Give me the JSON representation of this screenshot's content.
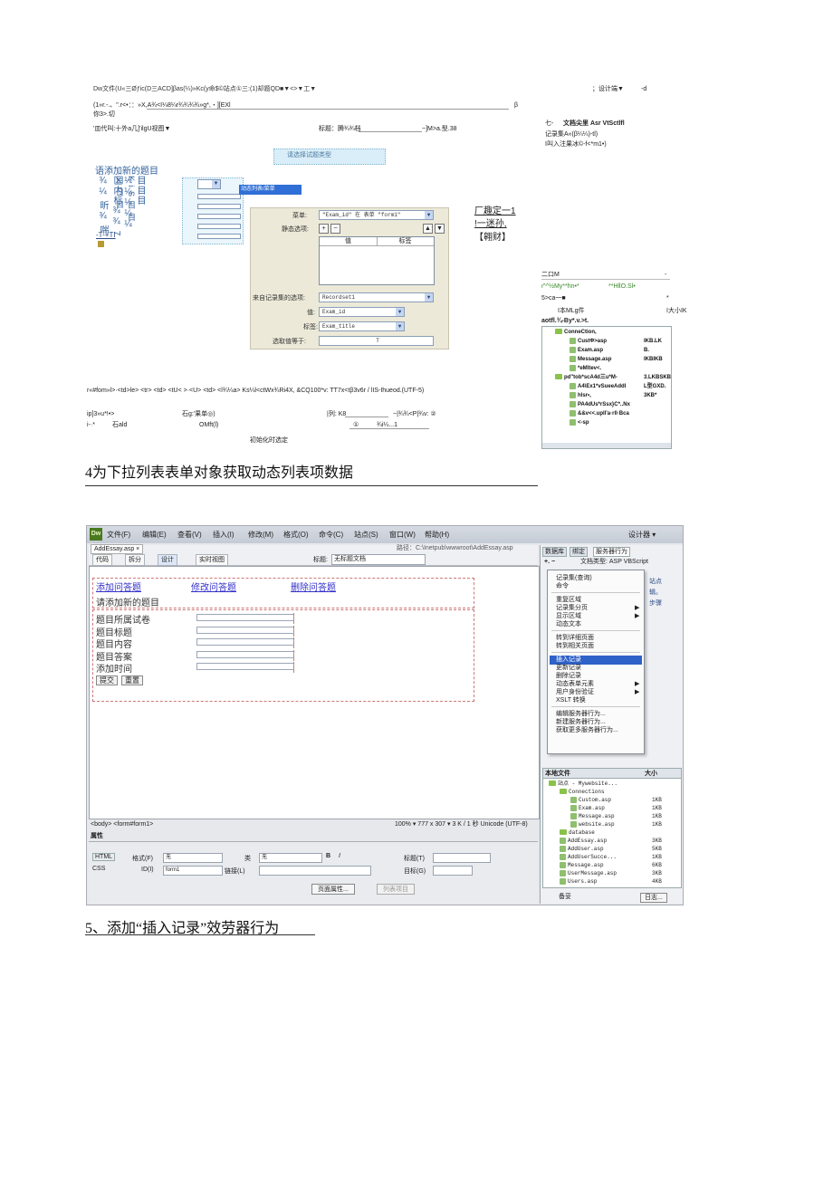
{
  "shot1": {
    "menu_line": "Dw文件(U«三Øƒic(D三ACD]βas(¼)»Kc(y命$©站点①三:(1)却题QD■▼<>▼工▼",
    "top_right": "；设计端▼",
    "top_right2": "-d",
    "toolbar_line": "(1»r.-.、\".r<•：：»X,A¾<I¼8¼r¾¾¾¾»g*,・][EXl",
    "toolbar_end": "β",
    "tab_label": "你3>.切",
    "view_line": "'皿代叫:十外a几]'ilgU视图▼",
    "title_field": "标题：腾¾¾档",
    "title_right": "~]M>a.型.38",
    "right_hdr1": "七-",
    "right_hdr2": "文档尖里 Asr VtSctlfl",
    "right_hdr3": "记录集A«(β¼¼)-tl)",
    "right_hdr4": "I叫入注果冰©-f<*m1•)",
    "cyan_label": "请选择试题类型",
    "form_heading": "语添加新的题目",
    "vertical_text": "目目目¼¼¼¼¼ 区内标¾¾ 7 ¾¼ 昕¾ 喘",
    "vertical_text2": "K i S 目 目 目 日 目",
    "small_link": "-T-+TI",
    "blue_label": "动态列表/菜单",
    "dlg_menu_label": "菜单:",
    "dlg_menu_value": "\"Exam_id\" 在 表单 \"form1\"",
    "dlg_static_label": "静态选项:",
    "dlg_col_value": "值",
    "dlg_col_label": "标签",
    "dlg_rs_label": "来自记录集的选项:",
    "dlg_rs_value": "Recordset1",
    "dlg_value_label": "值:",
    "dlg_value_value": "Exam_id",
    "dlg_tag_label": "标签:",
    "dlg_tag_value": "Exam_title",
    "dlg_select_label": "选取值等于:",
    "dlg_select_value": "T",
    "btn_ok": "厂趣定一1",
    "btn_cancel": "!一迷孙,",
    "btn_help": "【翱财】",
    "status_line": "r«#fom»l>·<td>le> <tr> <td> <tU< >·<U> <td> <l¾¼a> Ks¼l<ctWx¾Ri4X, &CQ100*v: TT7x<tβ3v6r / lIS-Ihueod.(UTF-5)",
    "props_line1_a": "ip]3»u*!•>",
    "props_line1_b": "石g:′果单◎)",
    "props_line1_c": "|列: K8",
    "props_line1_d": "~|¾¾<P|¾v: ②",
    "props_line2_a": "i-·*",
    "props_line2_b": "石ald",
    "props_line2_c": "OMft(l)",
    "props_line2_d": "①",
    "props_line2_e": "¾i¼...1",
    "props_bottom": "初始化时选定",
    "panel_a": "二口M",
    "panel_a_r": "-",
    "panel_b": "ι^^½My**hn•*",
    "panel_b_r": "**HllO.Sl•",
    "panel_c": "5>ca一■",
    "panel_c_r": "*",
    "panel_d": "I本MLg件",
    "panel_d_r": "I大小IK",
    "panel_e": "aotfl.¾-By*.v.>t.",
    "tree": [
      {
        "name": "ConneCtion,",
        "size": ""
      },
      {
        "name": "CustΦ>asp ",
        "size": "IKB.LK"
      },
      {
        "name": "Exam.asp",
        "size": "B."
      },
      {
        "name": "Message.asp",
        "size": "IKBIKB"
      },
      {
        "name": "*eMltev<.",
        "size": ""
      },
      {
        "name": "pd\"tob*scA4d三u*M-",
        "size": "3.LKBSKB"
      },
      {
        "name": "A4\\Ex1*vSueeAddl",
        "size": "L型GXD."
      },
      {
        "name": "hlsr•,",
        "size": "3KB*"
      },
      {
        "name": "PA4dUs*rSsx}C*..Nx",
        "size": ""
      },
      {
        "name": "&&v<<.upll'a·rll·Bca",
        "size": ""
      },
      {
        "name": "<-sp",
        "size": ""
      }
    ]
  },
  "caption1": "4为下拉列表表单对象获取动态列表项数据",
  "shot2": {
    "menus": [
      "文件(F)",
      "编辑(E)",
      "查看(V)",
      "插入(I)",
      "修改(M)",
      "格式(O)",
      "命令(C)",
      "站点(S)",
      "窗口(W)",
      "帮助(H)"
    ],
    "workspace": "设计器 ▾",
    "file_tab": "AddEssay.asp ×",
    "path": "路径：C:\\Inetpub\\wwwroot\\AddEssay.asp",
    "btn_code": "代码",
    "btn_split": "拆分",
    "btn_design": "设计",
    "btn_live": "实时视图",
    "title_label": "标题:",
    "title_value": "无标题文档",
    "nav1": "添加问答题",
    "nav2": "修改问答题",
    "nav3": "删除问答题",
    "heading": "请添加新的题目",
    "fields": [
      "题目所属试卷",
      "题目标题",
      "题目内容",
      "题目答案",
      "添加时间"
    ],
    "btn_submit": "提交",
    "btn_reset": "重置",
    "status": "<body> <form#form1>",
    "status_right": "100% ▾ 777 x 307 ▾ 3 K / 1 秒 Unicode (UTF-8)",
    "props_title": "属性",
    "p_html": "HTML",
    "p_css": "CSS",
    "p_format_label": "格式(F)",
    "p_format_value": "无",
    "p_class_label": "类",
    "p_class_value": "无",
    "p_id_label": "ID(I)",
    "p_id_value": "form1",
    "p_link_label": "链接(L)",
    "p_target_label": "目标(G)",
    "p_title_label": "标题(T)",
    "p_page_btn": "页面属性...",
    "p_list_btn": "列表项目",
    "panel_tabs": [
      "数据库",
      "绑定",
      "服务器行为"
    ],
    "doc_type": "文档类型: ASP VBScript",
    "ctx_items": [
      "记录集(查询)",
      "命令",
      "---",
      "重复区域",
      "记录集分页",
      "显示区域",
      "动态文本",
      "---",
      "转到详细页面",
      "转到相关页面",
      "---",
      "插入记录",
      "更新记录",
      "删除记录",
      "动态表单元素",
      "用户身份验证",
      "XSLT 转换",
      "---",
      "编辑服务器行为...",
      "新建服务器行为...",
      "获取更多服务器行为..."
    ],
    "ctx_highlight": "插入记录",
    "right_snippets": [
      "站点",
      "辑。",
      "步骤"
    ],
    "files_header_l": "本地文件",
    "files_header_r": "大小",
    "files_tree": [
      {
        "name": "站点 - Mywebsite...",
        "size": "",
        "kind": "folder",
        "indent": 0
      },
      {
        "name": "Connections",
        "size": "",
        "kind": "folder",
        "indent": 1
      },
      {
        "name": "Custom.asp",
        "size": "1KB",
        "kind": "file",
        "indent": 2
      },
      {
        "name": "Exam.asp",
        "size": "1KB",
        "kind": "file",
        "indent": 2
      },
      {
        "name": "Message.asp",
        "size": "1KB",
        "kind": "file",
        "indent": 2
      },
      {
        "name": "website.asp",
        "size": "1KB",
        "kind": "file",
        "indent": 2
      },
      {
        "name": "database",
        "size": "",
        "kind": "folder",
        "indent": 1
      },
      {
        "name": "AddEssay.asp",
        "size": "3KB",
        "kind": "file",
        "indent": 1
      },
      {
        "name": "AddUser.asp",
        "size": "5KB",
        "kind": "file",
        "indent": 1
      },
      {
        "name": "AddUserSucce...",
        "size": "1KB",
        "kind": "file",
        "indent": 1
      },
      {
        "name": "Message.asp",
        "size": "6KB",
        "kind": "file",
        "indent": 1
      },
      {
        "name": "UserMessage.asp",
        "size": "3KB",
        "kind": "file",
        "indent": 1
      },
      {
        "name": "Users.asp",
        "size": "4KB",
        "kind": "file",
        "indent": 1
      }
    ],
    "bottom_left": "备妥",
    "bottom_right": "日志..."
  },
  "caption2": "5、添加“插入记录”效劳器行为"
}
